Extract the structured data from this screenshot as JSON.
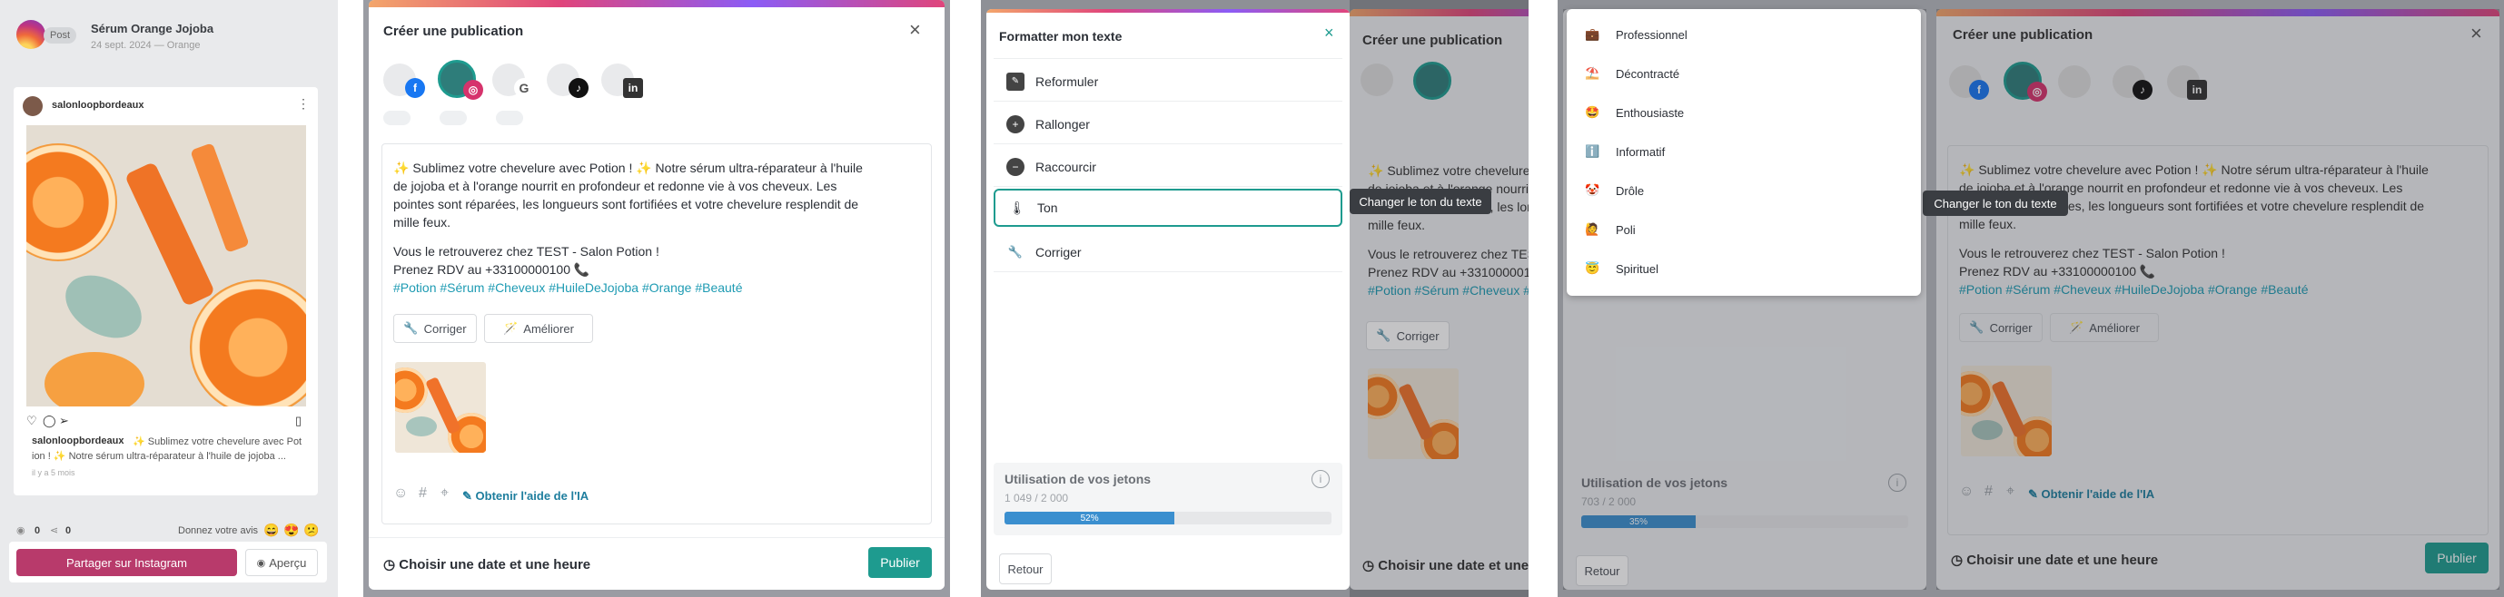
{
  "panel1": {
    "badge": "Post",
    "title": "Sérum Orange Jojoba",
    "subtitle": "24 sept. 2024 — Orange",
    "account": "salonloopbordeaux",
    "caption_user": "salonloopbordeaux",
    "caption_lines": [
      "✨ Sublimez votre chevelure avec Pot",
      "ion ! ✨ Notre sérum ultra-réparateur à l'huile de jojoba ..."
    ],
    "time_ago": "il y a 5 mois",
    "views": "0",
    "shares": "0",
    "avis_label": "Donnez votre avis",
    "avis_emojis": [
      "😄",
      "😍",
      "😕"
    ],
    "share_button": "Partager sur Instagram",
    "preview_button": "Aperçu"
  },
  "post": {
    "modal_title": "Créer une publication",
    "line1": "✨ Sublimez votre chevelure avec Potion ! ✨ Notre sérum ultra-réparateur à l'huile",
    "line2": "de jojoba et à l'orange nourrit en profondeur et redonne vie à vos cheveux.  Les",
    "line3": "pointes sont réparées, les longueurs sont fortifiées et votre chevelure resplendit de",
    "line4": "mille feux.",
    "line5": "Vous le retrouverez chez  TEST - Salon Potion !",
    "line6": "Prenez RDV au  +33100000100 📞",
    "hashtags": "#Potion #Sérum #Cheveux #HuileDeJojoba #Orange #Beauté",
    "corriger": "Corriger",
    "ameliorer": "Améliorer",
    "ai_help": "Obtenir l'aide de l'IA",
    "date_label": "Choisir une date et une heure",
    "publish": "Publier"
  },
  "format": {
    "title": "Formatter mon texte",
    "items": [
      "Reformuler",
      "Rallonger",
      "Raccourcir",
      "Ton",
      "Corriger"
    ],
    "tooltip": "Changer le ton du texte",
    "jetons_title": "Utilisation de vos jetons",
    "jetons_count": "1 049 / 2 000",
    "jetons_percent": "52%",
    "retour": "Retour"
  },
  "tone": {
    "items": [
      {
        "emoji": "💼",
        "label": "Professionnel"
      },
      {
        "emoji": "⛱️",
        "label": "Décontracté"
      },
      {
        "emoji": "🤩",
        "label": "Enthousiaste"
      },
      {
        "emoji": "ℹ️",
        "label": "Informatif"
      },
      {
        "emoji": "🤡",
        "label": "Drôle"
      },
      {
        "emoji": "🙋",
        "label": "Poli"
      },
      {
        "emoji": "😇",
        "label": "Spirituel"
      }
    ],
    "tooltip": "Changer le ton du texte",
    "jetons_title": "Utilisation de vos jetons",
    "jetons_count": "703 / 2 000",
    "jetons_percent": "35%",
    "retour": "Retour"
  },
  "progress": {
    "format_fraction": 0.52,
    "tone_fraction": 0.35
  },
  "colors": {
    "accent": "#1e9b8f",
    "instagram": "#b83a6b",
    "link": "#1e9bb3",
    "progress": "#3b8fcf"
  }
}
